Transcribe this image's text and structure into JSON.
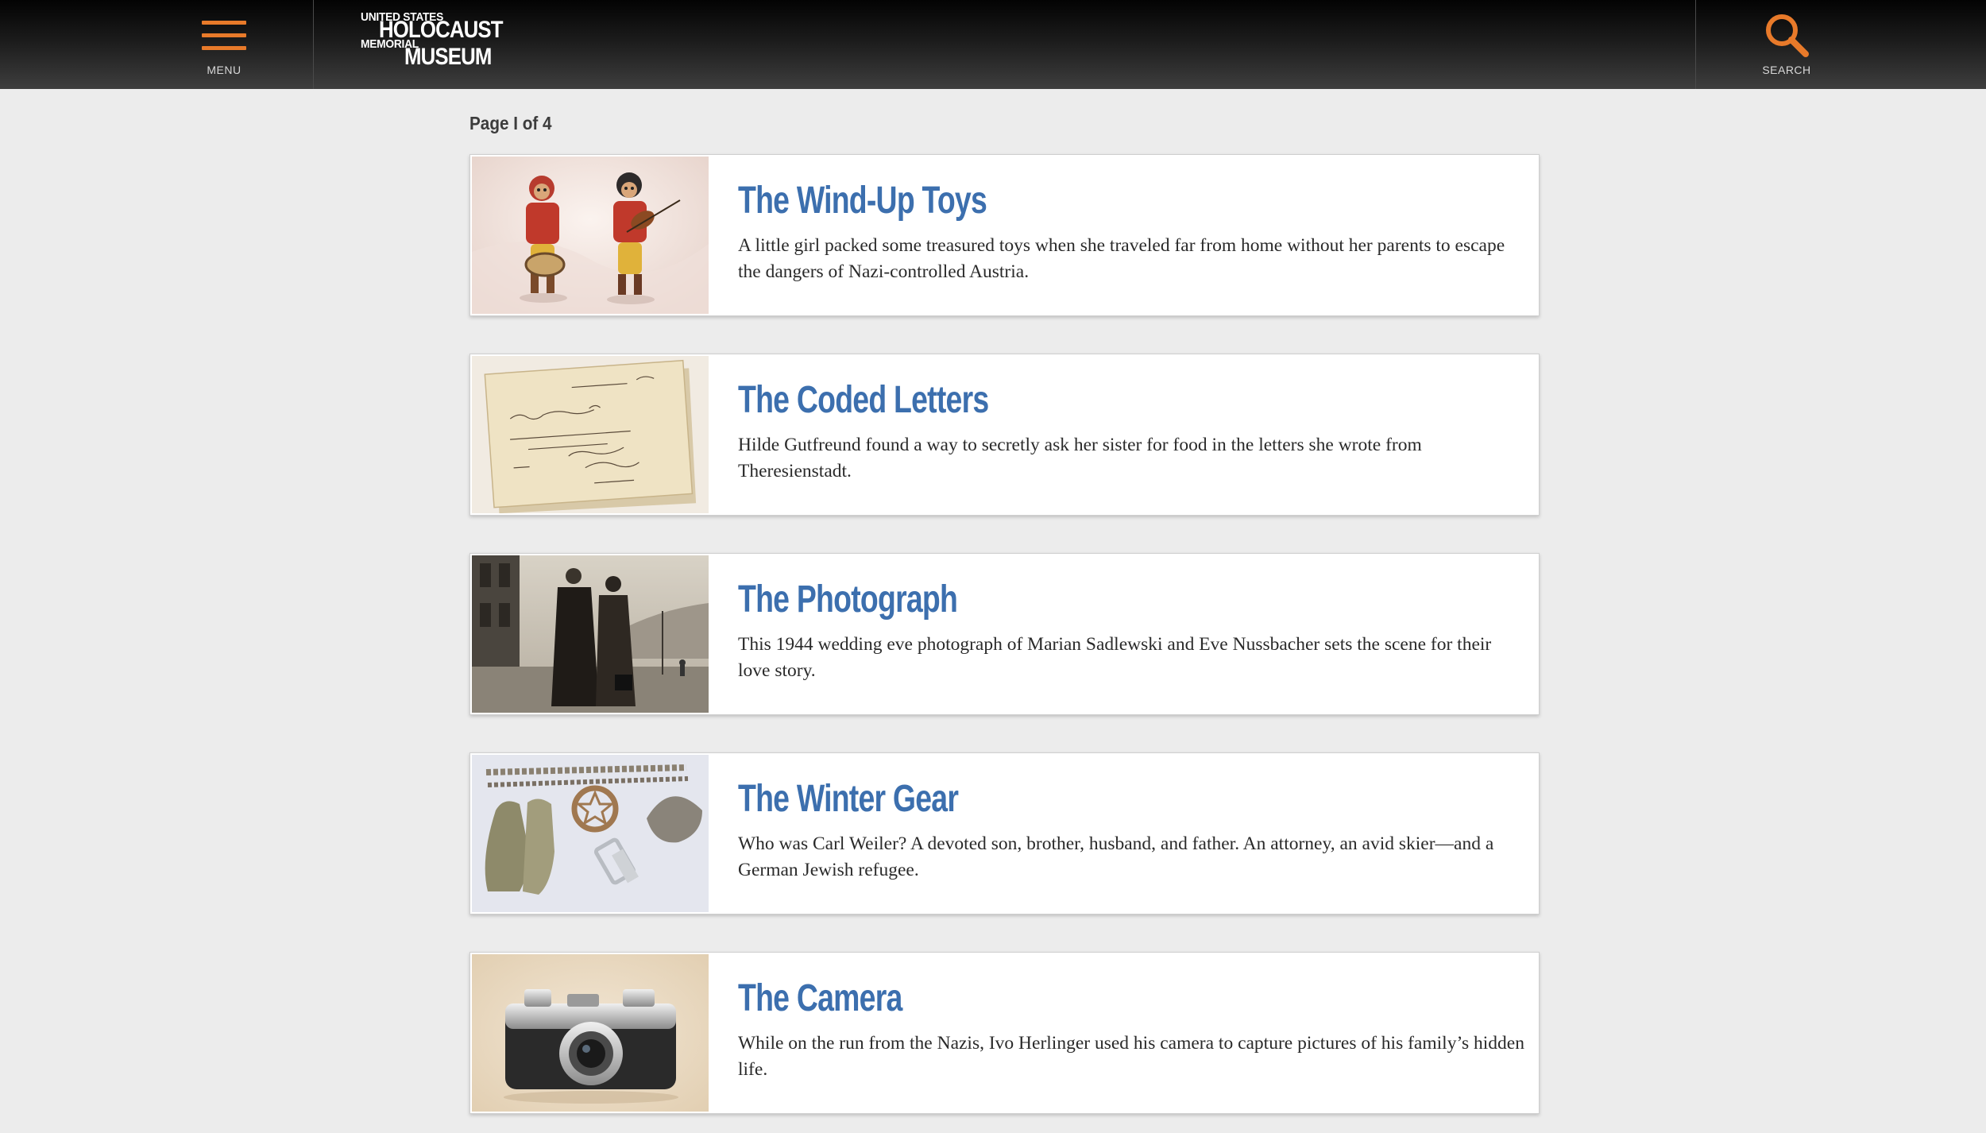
{
  "header": {
    "menu_label": "MENU",
    "search_label": "SEARCH",
    "accent_color": "#e87a2a",
    "logo": {
      "line1": "UNITED STATES",
      "line2": "HOLOCAUST",
      "line3": "MEMORIAL",
      "line4": "MUSEUM"
    }
  },
  "pagination": {
    "label": "Page I of 4"
  },
  "title_color": "#3c6fae",
  "stories": [
    {
      "title": "The Wind-Up Toys",
      "description": "A little girl packed some treasured toys when she traveled far from home without her parents to escape the dangers of Nazi-controlled Austria.",
      "image": "wind-up-toys-photo"
    },
    {
      "title": "The Coded Letters",
      "description": "Hilde Gutfreund found a way to secretly ask her sister for food in the letters she wrote from Theresienstadt.",
      "image": "coded-letters-photo"
    },
    {
      "title": "The Photograph",
      "description": "This 1944 wedding eve photograph of Marian Sadlewski and Eve Nussbacher sets the scene for their love story.",
      "image": "wedding-photograph"
    },
    {
      "title": "The Winter Gear",
      "description": "Who was Carl Weiler? A devoted son, brother, husband, and father. An attorney, an avid skier—and a German Jewish refugee.",
      "image": "winter-gear-photo"
    },
    {
      "title": "The Camera",
      "description": "While on the run from the Nazis, Ivo Herlinger used his camera to capture pictures of his family’s hidden life.",
      "image": "camera-photo"
    }
  ]
}
